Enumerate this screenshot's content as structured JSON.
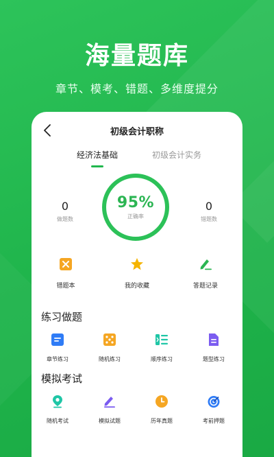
{
  "promo": {
    "headline": "海量题库",
    "subline": "章节、模考、错题、多维度提分"
  },
  "header": {
    "title": "初级会计职称"
  },
  "tabs": [
    {
      "label": "经济法基础",
      "active": true
    },
    {
      "label": "初级会计实务",
      "active": false
    }
  ],
  "stats": {
    "done_count": "0",
    "done_label": "做题数",
    "accuracy": "95%",
    "accuracy_label": "正确率",
    "wrong_count": "0",
    "wrong_label": "错题数"
  },
  "quick_actions": [
    {
      "label": "错题本",
      "icon": "wrong-book-icon"
    },
    {
      "label": "我的收藏",
      "icon": "star-icon"
    },
    {
      "label": "答题记录",
      "icon": "pen-record-icon"
    }
  ],
  "practice": {
    "title": "练习做题",
    "items": [
      {
        "label": "章节练习",
        "icon": "chapter-icon"
      },
      {
        "label": "随机练习",
        "icon": "dice-icon"
      },
      {
        "label": "顺序练习",
        "icon": "sequence-icon"
      },
      {
        "label": "题型练习",
        "icon": "document-icon"
      }
    ]
  },
  "exam": {
    "title": "模拟考试",
    "items": [
      {
        "label": "随机考试",
        "icon": "location-pin-icon"
      },
      {
        "label": "模拟试题",
        "icon": "pencil-icon"
      },
      {
        "label": "历年真题",
        "icon": "clock-icon"
      },
      {
        "label": "考前押题",
        "icon": "target-icon"
      }
    ]
  },
  "colors": {
    "brand_green": "#20b74d",
    "ring_green": "#2cc158",
    "icon_orange": "#f5a623",
    "icon_blue": "#2f7cf6",
    "icon_purple": "#7b5cf0",
    "icon_teal": "#1fc6a6"
  }
}
